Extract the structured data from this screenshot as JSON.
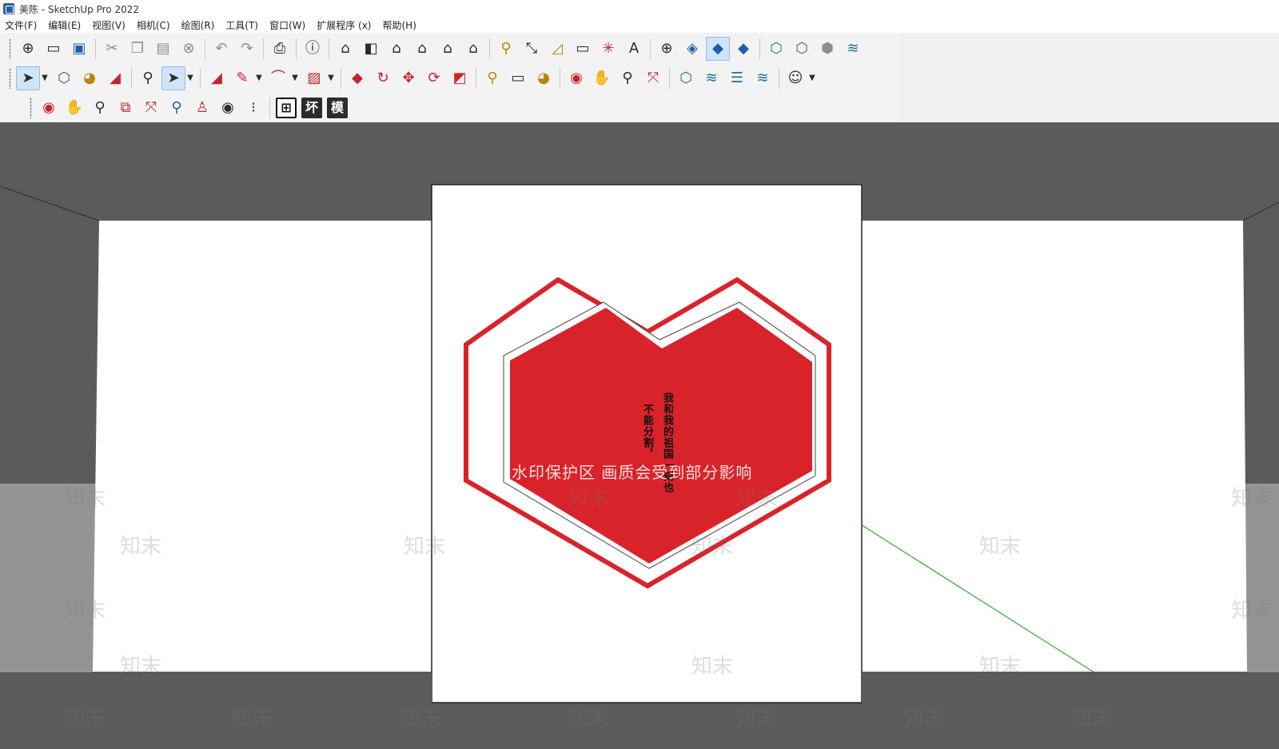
{
  "window": {
    "title": "美陈 - SketchUp Pro 2022"
  },
  "menu": [
    {
      "label": "文件(F)"
    },
    {
      "label": "编辑(E)"
    },
    {
      "label": "视图(V)"
    },
    {
      "label": "相机(C)"
    },
    {
      "label": "绘图(R)"
    },
    {
      "label": "工具(T)"
    },
    {
      "label": "窗口(W)"
    },
    {
      "label": "扩展程序 (x)"
    },
    {
      "label": "帮助(H)"
    }
  ],
  "toolbar3": {
    "labels": [
      "⊞",
      "坏",
      "模"
    ]
  },
  "model": {
    "heart_text_lines": [
      "我和我的祖国一刻也",
      "不能分割，"
    ],
    "colors": {
      "background": "#5b5b5b",
      "wall": "#ffffff",
      "heart_red": "#d9232a",
      "green_axis": "#2ea82e"
    }
  },
  "watermark": {
    "notice": "水印保护区  画质会受到部分影响",
    "logo_text": "知末"
  }
}
